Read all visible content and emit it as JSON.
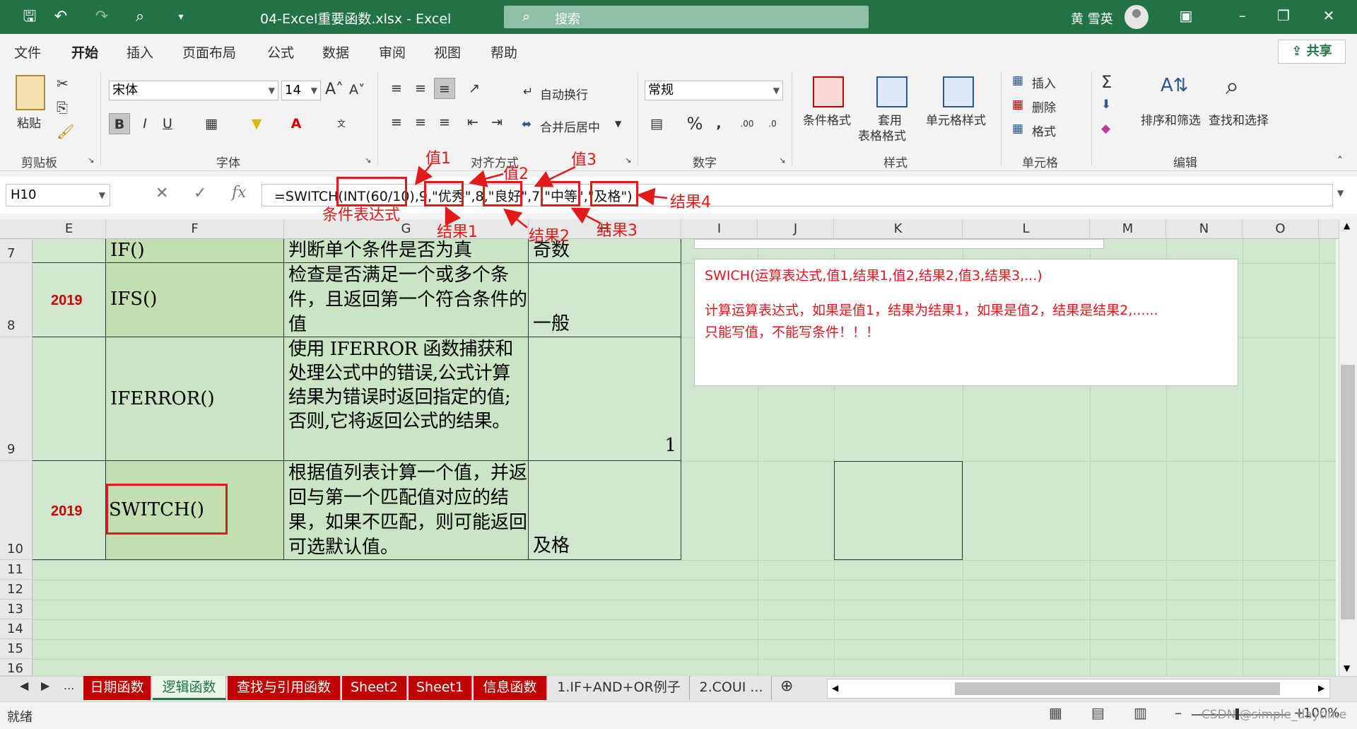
{
  "titlebar": {
    "filename": "04-Excel重要函数.xlsx  -  Excel",
    "search_placeholder": "搜索",
    "user": "黄 雪英"
  },
  "tabs": [
    "文件",
    "开始",
    "插入",
    "页面布局",
    "公式",
    "数据",
    "审阅",
    "视图",
    "帮助"
  ],
  "active_tab": "开始",
  "share_label": "共享",
  "ribbon": {
    "clipboard": {
      "paste": "粘贴",
      "label": "剪贴板"
    },
    "font": {
      "name": "宋体",
      "size": "14",
      "label": "字体",
      "bold": "B",
      "italic": "I",
      "underline": "U"
    },
    "align": {
      "wrap": "自动换行",
      "merge": "合并后居中",
      "label": "对齐方式"
    },
    "number": {
      "format": "常规",
      "label": "数字"
    },
    "styles": {
      "cond": "条件格式",
      "table1": "套用",
      "table2": "表格格式",
      "cell": "单元格样式",
      "label": "样式"
    },
    "cells": {
      "insert": "插入",
      "delete": "删除",
      "format": "格式",
      "label": "单元格"
    },
    "edit": {
      "sort": "排序和筛选",
      "find": "查找和选择",
      "label": "编辑"
    }
  },
  "formula_bar": {
    "name_box": "H10",
    "fx": "fx",
    "formula": "=SWITCH(INT(60/10),9,\"优秀\",8,\"良好\",7,\"中等\",\"及格\")"
  },
  "columns": [
    "E",
    "F",
    "G",
    "H",
    "I",
    "J",
    "K",
    "L",
    "M",
    "N",
    "O"
  ],
  "rows": [
    {
      "num": "7",
      "year": "",
      "func": "IF()",
      "desc": "判断单个条件是否为真",
      "result": "奇数"
    },
    {
      "num": "8",
      "year": "2019",
      "func": "IFS()",
      "desc": "检查是否满足一个或多个条件，且返回第一个符合条件的值",
      "result": "一般"
    },
    {
      "num": "9",
      "year": "",
      "func": "IFERROR()",
      "desc": "使用 IFERROR 函数捕获和处理公式中的错误,公式计算结果为错误时返回指定的值;否则,它将返回公式的结果。",
      "result": "1"
    },
    {
      "num": "10",
      "year": "2019",
      "func": "SWITCH()",
      "desc": "根据值列表计算一个值，并返回与第一个匹配值对应的结果，如果不匹配，则可能返回可选默认值。",
      "result": "及格"
    }
  ],
  "empty_rows": [
    "11",
    "12",
    "13",
    "14",
    "15",
    "16"
  ],
  "note": {
    "line1": "SWICH(运算表达式,值1,结果1,值2,结果2,值3,结果3,...)",
    "line2": "计算运算表达式，如果是值1，结果为结果1，如果是值2，结果是结果2,......",
    "line3": "只能写值，不能写条件！！！"
  },
  "annotations": {
    "expr": "条件表达式",
    "v1": "值1",
    "v2": "值2",
    "v3": "值3",
    "r1": "结果1",
    "r2": "结果2",
    "r3": "结果3",
    "r4": "结果4"
  },
  "sheets": [
    {
      "name": "日期函数",
      "style": "red"
    },
    {
      "name": "逻辑函数",
      "style": "active"
    },
    {
      "name": "查找与引用函数",
      "style": "red"
    },
    {
      "name": "Sheet2",
      "style": "red"
    },
    {
      "name": "Sheet1",
      "style": "red"
    },
    {
      "name": "信息函数",
      "style": "red"
    },
    {
      "name": "1.IF+AND+OR例子",
      "style": "plain"
    },
    {
      "name": "2.COUI ...",
      "style": "plain"
    }
  ],
  "status": {
    "ready": "就绪",
    "zoom": "100%",
    "watermark": "CSDN @simple_daytime"
  },
  "colors": {
    "excel_green": "#217346",
    "annotation_red": "#e21a1a",
    "sheet_red": "#c00000"
  }
}
